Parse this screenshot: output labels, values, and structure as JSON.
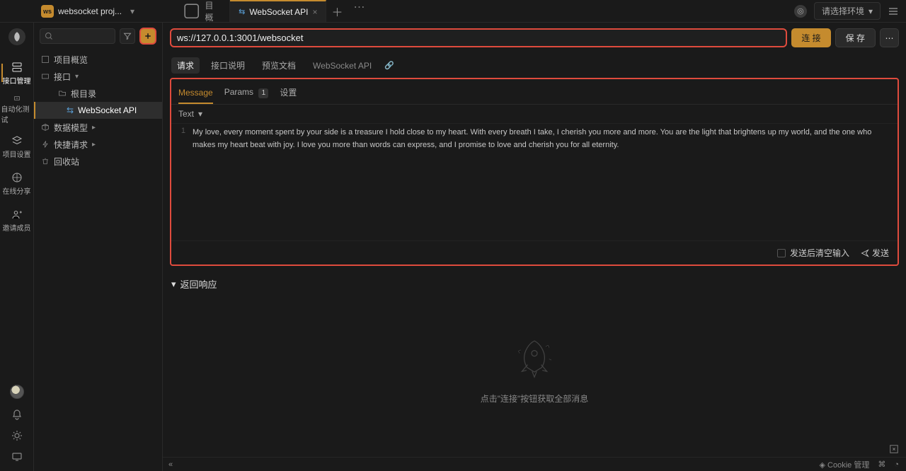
{
  "topbar": {
    "project_name": "websocket proj...",
    "tabs": [
      {
        "label": "项目概览"
      },
      {
        "label": "WebSocket API",
        "active": true
      }
    ],
    "env_placeholder": "请选择环境"
  },
  "rail": {
    "items": [
      {
        "label": "接口管理",
        "active": true
      },
      {
        "label": "自动化测试"
      },
      {
        "label": "项目设置"
      },
      {
        "label": "在线分享"
      },
      {
        "label": "邀请成员"
      }
    ]
  },
  "sidebar": {
    "items": [
      {
        "label": "项目概览"
      },
      {
        "label": "接口"
      },
      {
        "label": "根目录"
      },
      {
        "label": "WebSocket API"
      },
      {
        "label": "数据模型"
      },
      {
        "label": "快捷请求"
      },
      {
        "label": "回收站"
      }
    ]
  },
  "url_bar": {
    "value": "ws://127.0.0.1:3001/websocket",
    "connect_label": "连 接",
    "save_label": "保 存"
  },
  "doc_tabs": {
    "items": [
      "请求",
      "接口说明",
      "预览文档",
      "WebSocket API"
    ]
  },
  "inner_tabs": {
    "items": [
      {
        "label": "Message",
        "active": true
      },
      {
        "label": "Params",
        "badge": "1"
      },
      {
        "label": "设置"
      }
    ],
    "payload_type": "Text"
  },
  "editor": {
    "line_no": "1",
    "text": "My love, every moment spent by your side is a treasure I hold close to my heart. With every breath I take, I cherish you more and more. You are the light that brightens up my world, and the one who makes my heart beat with joy. I love you more than words can express, and I promise to love and cherish you for all eternity."
  },
  "panel_footer": {
    "clear_label": "发送后清空输入",
    "send_label": "发送"
  },
  "response": {
    "title": "返回响应",
    "empty_hint": "点击\"连接\"按钮获取全部消息"
  },
  "bottombar": {
    "cookie_label": "Cookie 管理"
  }
}
